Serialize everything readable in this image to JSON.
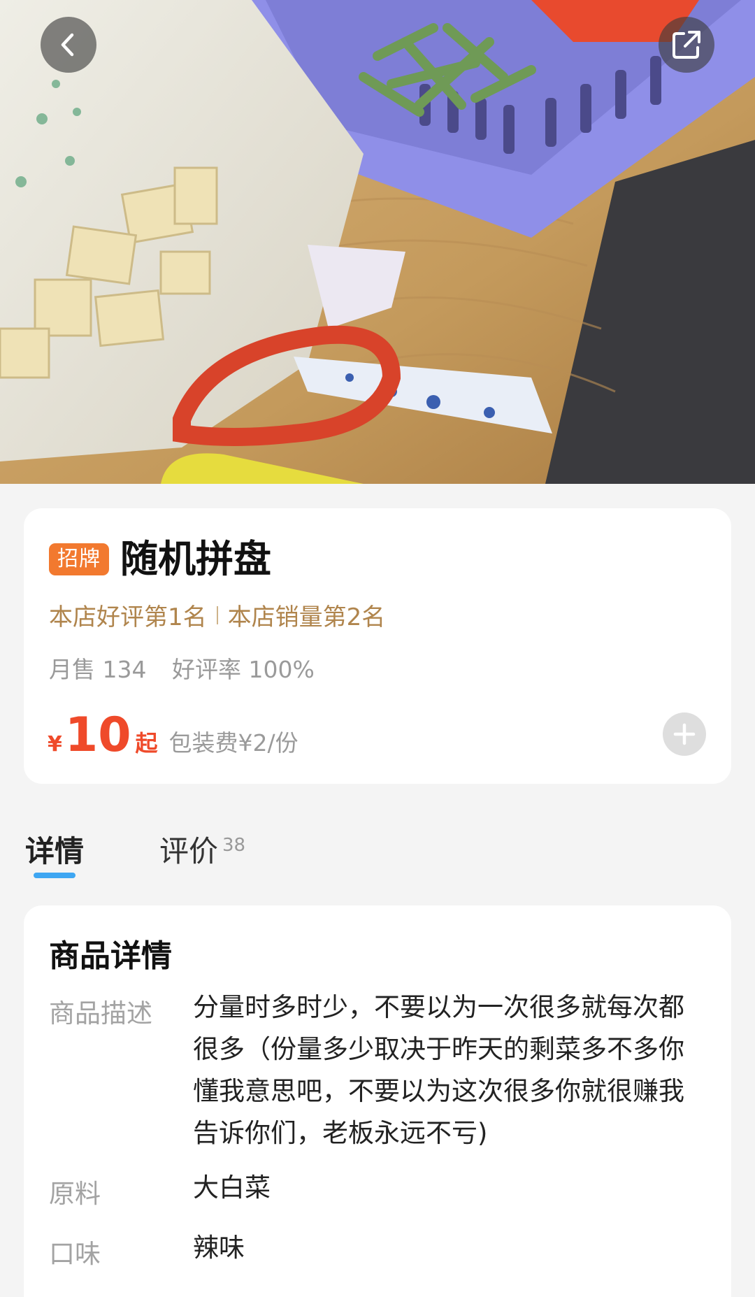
{
  "nav": {
    "back_icon": "chevron-left-icon",
    "share_icon": "share-external-icon"
  },
  "product": {
    "badge": "招牌",
    "name": "随机拼盘",
    "rank_good": "本店好评第1名",
    "rank_sales": "本店销量第2名",
    "monthly_sales": "月售 134",
    "good_rate": "好评率 100%",
    "currency": "¥",
    "price": "10",
    "price_suffix": "起",
    "packing_fee": "包装费¥2/份",
    "accent_color": "#ef4a2a",
    "badge_color": "#f2792f"
  },
  "tabs": {
    "details": "详情",
    "reviews": "评价",
    "reviews_count": "38",
    "active": "details",
    "active_color": "#3ea6f2"
  },
  "details": {
    "section_title": "商品详情",
    "desc_label": "商品描述",
    "desc_value": "分量时多时少，不要以为一次很多就每次都很多（份量多少取决于昨天的剩菜多不多你懂我意思吧，不要以为这次很多你就很赚我告诉你们，老板永远不亏)",
    "ingredient_label": "原料",
    "ingredient_value": "大白菜",
    "flavor_label": "口味",
    "flavor_value": "辣味"
  }
}
